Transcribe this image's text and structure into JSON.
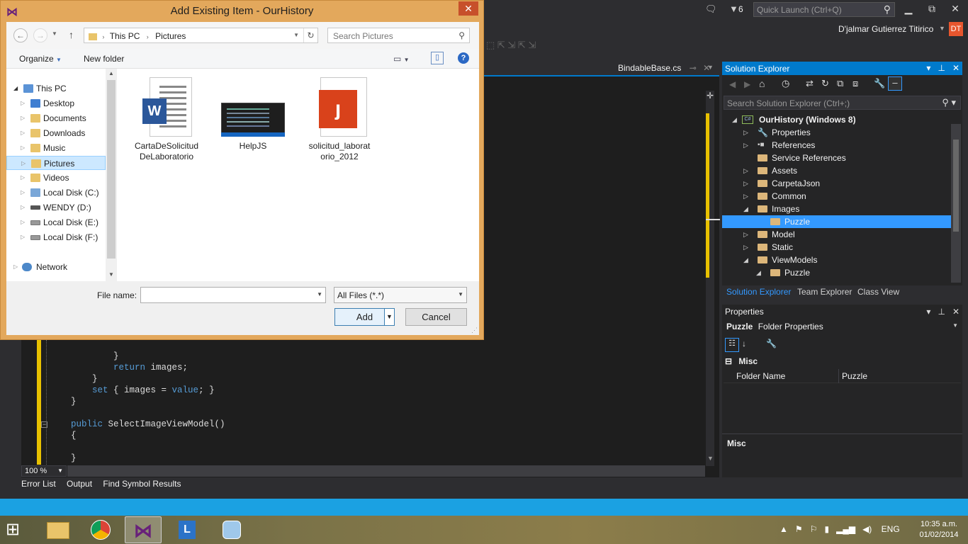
{
  "vs": {
    "notifications_count": "6",
    "quick_launch_placeholder": "Quick Launch (Ctrl+Q)",
    "user_name": "D'jalmar Gutierrez Titirico",
    "user_initials": "DT",
    "editor_tab": "BindableBase.cs",
    "code_lines": [
      {
        "indent": "            ",
        "text": "}"
      },
      {
        "indent": "            ",
        "kw": "return",
        "text": " images;"
      },
      {
        "indent": "        ",
        "text": "}"
      },
      {
        "indent": "        ",
        "kw": "set",
        "text": " { images = ",
        "kw2": "value",
        "text2": "; }"
      },
      {
        "indent": "    ",
        "text": "}"
      },
      {
        "indent": "",
        "text": ""
      },
      {
        "indent": "    ",
        "kw": "public",
        "text": " SelectImageViewModel()"
      },
      {
        "indent": "    ",
        "text": "{"
      },
      {
        "indent": "",
        "text": ""
      },
      {
        "indent": "    ",
        "text": "}"
      }
    ],
    "zoom": "100 %",
    "bottom_tabs": [
      "Error List",
      "Output",
      "Find Symbol Results"
    ],
    "accent": "#007acc",
    "status_color": "#1ba1e2"
  },
  "solution_explorer": {
    "title": "Solution Explorer",
    "search_placeholder": "Search Solution Explorer (Ctrl+;)",
    "tree": [
      {
        "label": "OurHistory (Windows 8)",
        "level": 0,
        "arrow": "◢",
        "type": "project"
      },
      {
        "label": "Properties",
        "level": 1,
        "arrow": "▷",
        "type": "wrench"
      },
      {
        "label": "References",
        "level": 1,
        "arrow": "▷",
        "type": "refs"
      },
      {
        "label": "Service References",
        "level": 1,
        "arrow": "",
        "type": "folder"
      },
      {
        "label": "Assets",
        "level": 1,
        "arrow": "▷",
        "type": "folder"
      },
      {
        "label": "CarpetaJson",
        "level": 1,
        "arrow": "▷",
        "type": "folder"
      },
      {
        "label": "Common",
        "level": 1,
        "arrow": "▷",
        "type": "folder"
      },
      {
        "label": "Images",
        "level": 1,
        "arrow": "◢",
        "type": "folder"
      },
      {
        "label": "Puzzle",
        "level": 2,
        "arrow": "",
        "type": "folder",
        "selected": true
      },
      {
        "label": "Model",
        "level": 1,
        "arrow": "▷",
        "type": "folder"
      },
      {
        "label": "Static",
        "level": 1,
        "arrow": "▷",
        "type": "folder"
      },
      {
        "label": "ViewModels",
        "level": 1,
        "arrow": "◢",
        "type": "folder"
      },
      {
        "label": "Puzzle",
        "level": 2,
        "arrow": "◢",
        "type": "folder"
      }
    ],
    "tabs": [
      "Solution Explorer",
      "Team Explorer",
      "Class View"
    ]
  },
  "properties": {
    "title": "Properties",
    "object_name": "Puzzle",
    "object_type": "Folder Properties",
    "category": "Misc",
    "rows": [
      {
        "name": "Folder Name",
        "value": "Puzzle"
      }
    ],
    "description_title": "Misc"
  },
  "dialog": {
    "title": "Add Existing Item - OurHistory",
    "address": [
      "This PC",
      "Pictures"
    ],
    "search_placeholder": "Search Pictures",
    "organize": "Organize",
    "new_folder": "New folder",
    "nav_items": [
      {
        "label": "This PC",
        "level": 0,
        "arrow": "◢",
        "icon": "pc-icon"
      },
      {
        "label": "Desktop",
        "level": 1,
        "arrow": "▷",
        "icon": "desktop-icon"
      },
      {
        "label": "Documents",
        "level": 1,
        "arrow": "▷",
        "icon": "documents-icon"
      },
      {
        "label": "Downloads",
        "level": 1,
        "arrow": "▷",
        "icon": "downloads-icon"
      },
      {
        "label": "Music",
        "level": 1,
        "arrow": "▷",
        "icon": "music-icon"
      },
      {
        "label": "Pictures",
        "level": 1,
        "arrow": "▷",
        "icon": "pictures-icon",
        "selected": true
      },
      {
        "label": "Videos",
        "level": 1,
        "arrow": "▷",
        "icon": "videos-icon"
      },
      {
        "label": "Local Disk (C:)",
        "level": 1,
        "arrow": "▷",
        "icon": "windows-disk-icon"
      },
      {
        "label": "WENDY (D:)",
        "level": 1,
        "arrow": "▷",
        "icon": "usb-drive-icon"
      },
      {
        "label": "Local Disk (E:)",
        "level": 1,
        "arrow": "▷",
        "icon": "disk-icon"
      },
      {
        "label": "Local Disk (F:)",
        "level": 1,
        "arrow": "▷",
        "icon": "disk-icon"
      },
      {
        "label": "Network",
        "level": 0,
        "arrow": "▷",
        "icon": "network-icon"
      }
    ],
    "files": [
      {
        "name": "CartaDeSolicitud DeLaboratorio",
        "line1": "CartaDeSolicitud",
        "line2": "DeLaboratorio",
        "kind": "word-document-icon"
      },
      {
        "name": "HelpJS",
        "line1": "HelpJS",
        "line2": "",
        "kind": "image-thumbnail-icon"
      },
      {
        "name": "solicitud_laboratorio_2012",
        "line1": "solicitud_laborat",
        "line2": "orio_2012",
        "kind": "pdf-document-icon"
      }
    ],
    "file_name_label": "File name:",
    "file_name_value": "",
    "file_type": "All Files (*.*)",
    "add_label": "Add",
    "cancel_label": "Cancel"
  },
  "taskbar": {
    "language": "ENG",
    "time": "10:35 a.m.",
    "date": "01/02/2014",
    "apps": [
      "file-explorer-icon",
      "chrome-icon",
      "visual-studio-icon",
      "lync-icon",
      "finder-icon"
    ]
  }
}
